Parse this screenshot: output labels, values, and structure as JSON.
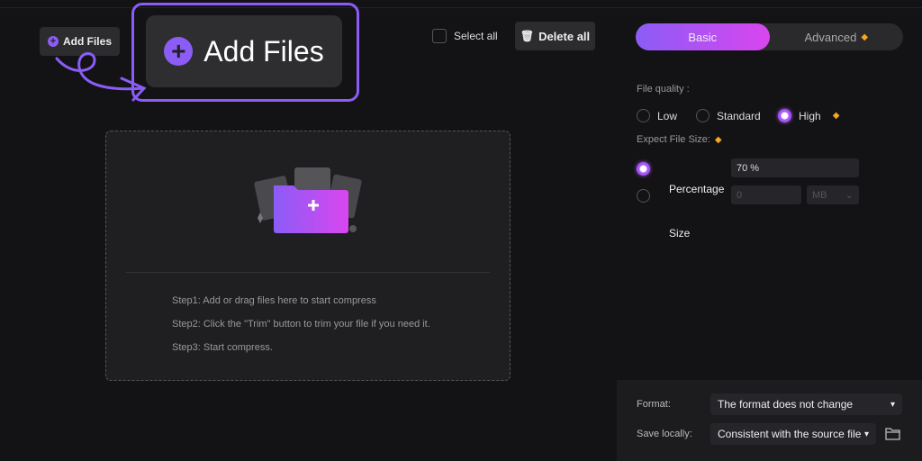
{
  "toolbar": {
    "add_files_small": "Add Files",
    "add_files_big": "Add Files",
    "select_all": "Select all",
    "delete_all": "Delete all"
  },
  "tabs": [
    {
      "label": "Basic"
    },
    {
      "label": "Advanced"
    }
  ],
  "dropzone": {
    "steps": [
      "Step1:  Add or drag files here to start compress",
      "Step2: Click the \"Trim\" button to trim your file if you need it.",
      "Step3: Start compress."
    ]
  },
  "settings": {
    "file_quality_label": "File quality :",
    "quality_options": [
      "Low",
      "Standard",
      "High"
    ],
    "quality_selected": "High",
    "expect_size_label": "Expect File Size:",
    "percentage_label": "Percentage",
    "percentage_value": "70 %",
    "size_label": "Size",
    "size_value": "0",
    "size_unit": "MB",
    "format_label": "Format:",
    "format_value": "The format does not change",
    "save_label": "Save locally:",
    "save_value": "Consistent with the source file"
  },
  "colors": {
    "accent": "#8b5cf6",
    "gradient_end": "#d946ef",
    "premium": "#f5a623"
  }
}
